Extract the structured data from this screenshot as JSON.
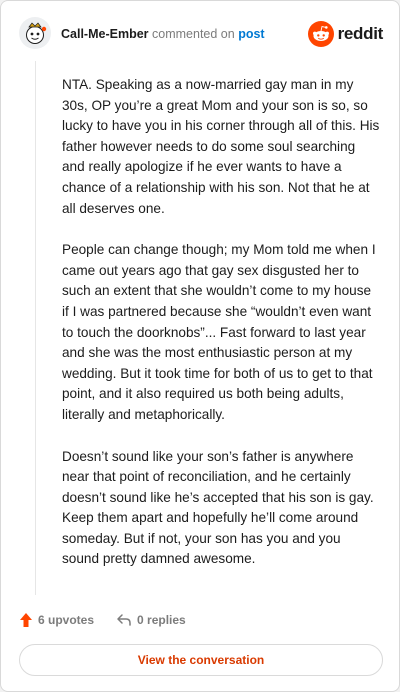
{
  "comment": {
    "username": "Call-Me-Ember",
    "commented_on": "commented on",
    "post_link": "post",
    "paragraphs": [
      "NTA. Speaking as a now-married gay man in my 30s, OP you’re a great Mom and your son is so, so lucky to have you in his corner through all of this. His father however needs to do some soul searching and really apologize if he ever wants to have a chance of a relationship with his son. Not that he at all deserves one.",
      "People can change though; my Mom told me when I came out years ago that gay sex disgusted her to such an extent that she wouldn’t come to my house if I was partnered because she “wouldn’t even want to touch the doorknobs”... Fast forward to last year and she was the most enthusiastic person at my wedding. But it took time for both of us to get to that point, and it also required us both being adults, literally and metaphorically.",
      "Doesn’t sound like your son’s father is anywhere near that point of reconciliation, and he certainly doesn’t sound like he’s accepted that his son is gay. Keep them apart and hopefully he’ll come around someday. But if not, your son has you and you sound pretty damned awesome."
    ]
  },
  "brand": {
    "logo_text": "reddit",
    "logo_icon": "reddit-alien-icon",
    "accent_color": "#ff4500"
  },
  "footer": {
    "upvotes_label": "6 upvotes",
    "replies_label": "0 replies"
  },
  "cta": {
    "label": "View the conversation"
  }
}
